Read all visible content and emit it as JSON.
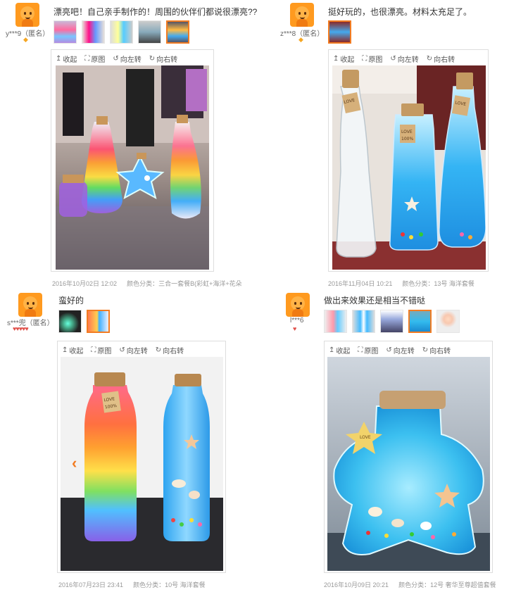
{
  "reviews": [
    {
      "nickname": "y***9（匿名）",
      "content": "漂亮吧！自己亲手制作的！周围的伙伴们都说很漂亮??",
      "level": "◆",
      "tools": {
        "collapse": "收起",
        "original": "原图",
        "rotate_left": "向左转",
        "rotate_right": "向右转"
      },
      "date": "2016年10月02日 12:02",
      "sku": "颜色分类：三合一套餐B(彩虹+海洋+花朵"
    },
    {
      "nickname": "z***8（匿名）",
      "content": "挺好玩的，也很漂亮。材料太充足了。",
      "level": "◆",
      "tools": {
        "collapse": "收起",
        "original": "原图",
        "rotate_left": "向左转",
        "rotate_right": "向右转"
      },
      "date": "2016年11月04日 10:21",
      "sku": "颜色分类：13号 海洋套餐"
    },
    {
      "nickname": "s***兜（匿名）",
      "content": "蛮好的",
      "level": "♥♥♥♥♥",
      "tools": {
        "collapse": "收起",
        "original": "原图",
        "rotate_left": "向左转",
        "rotate_right": "向右转"
      },
      "date": "2016年07月23日 23:41",
      "sku": "颜色分类：10号 海洋套餐"
    },
    {
      "nickname": "l***6",
      "content": "做出来效果还是相当不错哒",
      "level": "♥",
      "tools": {
        "collapse": "收起",
        "original": "原图",
        "rotate_left": "向左转",
        "rotate_right": "向右转"
      },
      "date": "2016年10月09日 20:21",
      "sku": "颜色分类：12号 奢华至尊超值套餐"
    }
  ],
  "photo_labels": {
    "tag": "LOVE 100%"
  },
  "colors": {
    "accent": "#f27c22",
    "meta": "#999999"
  }
}
